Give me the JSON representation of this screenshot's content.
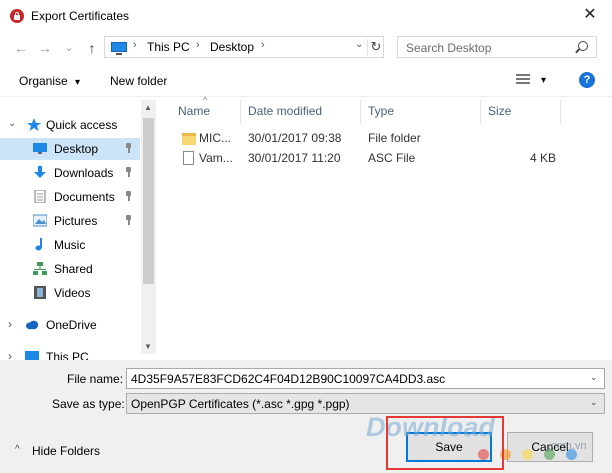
{
  "window": {
    "title": "Export Certificates",
    "close_glyph": "✕"
  },
  "nav": {
    "back_glyph": "←",
    "forward_glyph": "→",
    "recent_glyph": "⌄",
    "up_glyph": "↑",
    "breadcrumbs": [
      "This PC",
      "Desktop"
    ],
    "crumb_sep": "›",
    "refresh_glyph": "↻",
    "search_placeholder": "Search Desktop"
  },
  "toolbar": {
    "organise": "Organise",
    "organise_arrow": "▾",
    "new_folder": "New folder",
    "view_arrow": "▾",
    "help": "?"
  },
  "sidebar": {
    "items": [
      {
        "label": "Quick access",
        "icon": "star-icon",
        "color": "#1e88e5",
        "chevron": "⌄",
        "pinned": false,
        "selected": false
      },
      {
        "label": "Desktop",
        "icon": "desktop-folder-icon",
        "color": "#1e88e5",
        "pinned": true,
        "selected": true
      },
      {
        "label": "Downloads",
        "icon": "download-arrow-icon",
        "color": "#1e88e5",
        "pinned": true,
        "selected": false
      },
      {
        "label": "Documents",
        "icon": "documents-icon",
        "color": "#777777",
        "pinned": true,
        "selected": false
      },
      {
        "label": "Pictures",
        "icon": "pictures-icon",
        "color": "#4a90c8",
        "pinned": true,
        "selected": false
      },
      {
        "label": "Music",
        "icon": "music-note-icon",
        "color": "#1e88e5",
        "pinned": false,
        "selected": false
      },
      {
        "label": "Shared",
        "icon": "network-share-icon",
        "color": "#3d9b5b",
        "pinned": false,
        "selected": false
      },
      {
        "label": "Videos",
        "icon": "film-icon",
        "color": "#555555",
        "pinned": false,
        "selected": false
      },
      {
        "label": "OneDrive",
        "icon": "cloud-icon",
        "color": "#1565c0",
        "chevron": "›",
        "pinned": false,
        "selected": false
      },
      {
        "label": "This PC",
        "icon": "computer-icon",
        "color": "#1e88e5",
        "chevron": "›",
        "pinned": false,
        "selected": false
      }
    ]
  },
  "files": {
    "sort_glyph": "^",
    "columns": [
      "Name",
      "Date modified",
      "Type",
      "Size"
    ],
    "rows": [
      {
        "name": "MIC...",
        "date": "30/01/2017 09:38",
        "type": "File folder",
        "size": "",
        "icon": "folder-icon"
      },
      {
        "name": "Vam...",
        "date": "30/01/2017 11:20",
        "type": "ASC File",
        "size": "4 KB",
        "icon": "file-icon"
      }
    ]
  },
  "form": {
    "filename_label": "File name:",
    "filename_value": "4D35F9A57E83FCD62C4F04D12B90C10097CA4DD3.asc",
    "savetype_label": "Save as type:",
    "savetype_value": "OpenPGP Certificates (*.asc *.gpg *.pgp)",
    "dropdown_arrow": "⌄"
  },
  "footer": {
    "hide_folders": "Hide Folders",
    "hide_glyph": "^",
    "save": "Save",
    "cancel": "Cancel"
  },
  "watermark": {
    "text": "Download",
    "suffix": ".com.vn",
    "dot_colors": [
      "#e53935",
      "#fb8c00",
      "#fdd835",
      "#43a047",
      "#1e88e5"
    ]
  },
  "colors": {
    "accent": "#0078d7",
    "selection": "#cce4f7",
    "highlight": "#e53935"
  }
}
